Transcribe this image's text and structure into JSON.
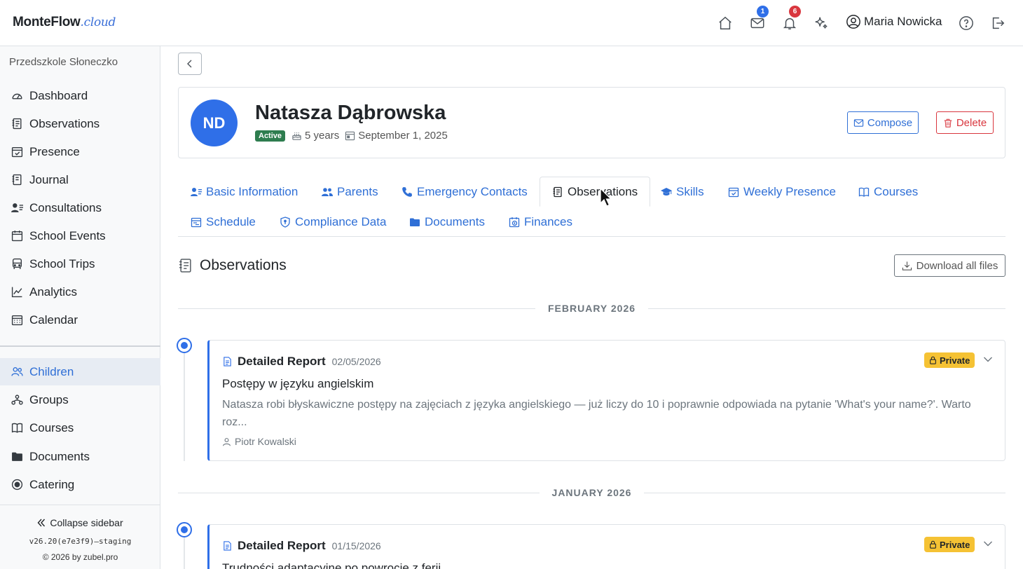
{
  "brand": {
    "name": "MonteFlow",
    "suffix": ".cloud"
  },
  "header": {
    "messages_count": "1",
    "notifications_count": "6",
    "user_name": "Maria Nowicka"
  },
  "sidebar": {
    "school": "Przedszkole Słoneczko",
    "items": [
      {
        "label": "Dashboard",
        "icon": "gauge-icon"
      },
      {
        "label": "Observations",
        "icon": "journal-text-icon"
      },
      {
        "label": "Presence",
        "icon": "calendar-check-icon"
      },
      {
        "label": "Journal",
        "icon": "journal-icon"
      },
      {
        "label": "Consultations",
        "icon": "person-lines-icon"
      },
      {
        "label": "School Events",
        "icon": "calendar-icon"
      },
      {
        "label": "School Trips",
        "icon": "bus-icon"
      },
      {
        "label": "Analytics",
        "icon": "graph-icon"
      },
      {
        "label": "Calendar",
        "icon": "calendar-grid-icon"
      }
    ],
    "items2": [
      {
        "label": "Children",
        "icon": "people-icon",
        "active": true
      },
      {
        "label": "Groups",
        "icon": "diagram-icon"
      },
      {
        "label": "Courses",
        "icon": "book-icon"
      },
      {
        "label": "Documents",
        "icon": "folder-icon"
      },
      {
        "label": "Catering",
        "icon": "plate-icon"
      }
    ],
    "collapse_label": "Collapse sidebar",
    "version": "v26.20(e7e3f9)–staging",
    "copyright": "© 2026 by zubel.pro"
  },
  "child": {
    "initials": "ND",
    "name": "Natasza Dąbrowska",
    "status": "Active",
    "age": "5 years",
    "start_date": "September 1, 2025"
  },
  "actions": {
    "compose": "Compose",
    "delete": "Delete"
  },
  "tabs": [
    {
      "label": "Basic Information"
    },
    {
      "label": "Parents"
    },
    {
      "label": "Emergency Contacts"
    },
    {
      "label": "Observations",
      "active": true
    },
    {
      "label": "Skills"
    },
    {
      "label": "Weekly Presence"
    },
    {
      "label": "Courses"
    },
    {
      "label": "Schedule"
    },
    {
      "label": "Compliance Data"
    },
    {
      "label": "Documents"
    },
    {
      "label": "Finances"
    }
  ],
  "section": {
    "title": "Observations",
    "download": "Download all files"
  },
  "months": [
    "FEBRUARY 2026",
    "JANUARY 2026"
  ],
  "observations": [
    {
      "type": "Detailed Report",
      "date": "02/05/2026",
      "visibility": "Private",
      "title": "Postępy w języku angielskim",
      "body": "Natasza robi błyskawiczne postępy na zajęciach z języka angielskiego — już liczy do 10 i poprawnie odpowiada na pytanie 'What's your name?'. Warto roz...",
      "author": "Piotr Kowalski"
    },
    {
      "type": "Detailed Report",
      "date": "01/15/2026",
      "visibility": "Private",
      "title": "Trudności adaptacyjne po powrocie z ferii"
    }
  ],
  "colors": {
    "accent": "#2f6fe8",
    "active_badge": "#2e7d4f",
    "private_badge": "#f5c234",
    "danger": "#d9363e"
  }
}
